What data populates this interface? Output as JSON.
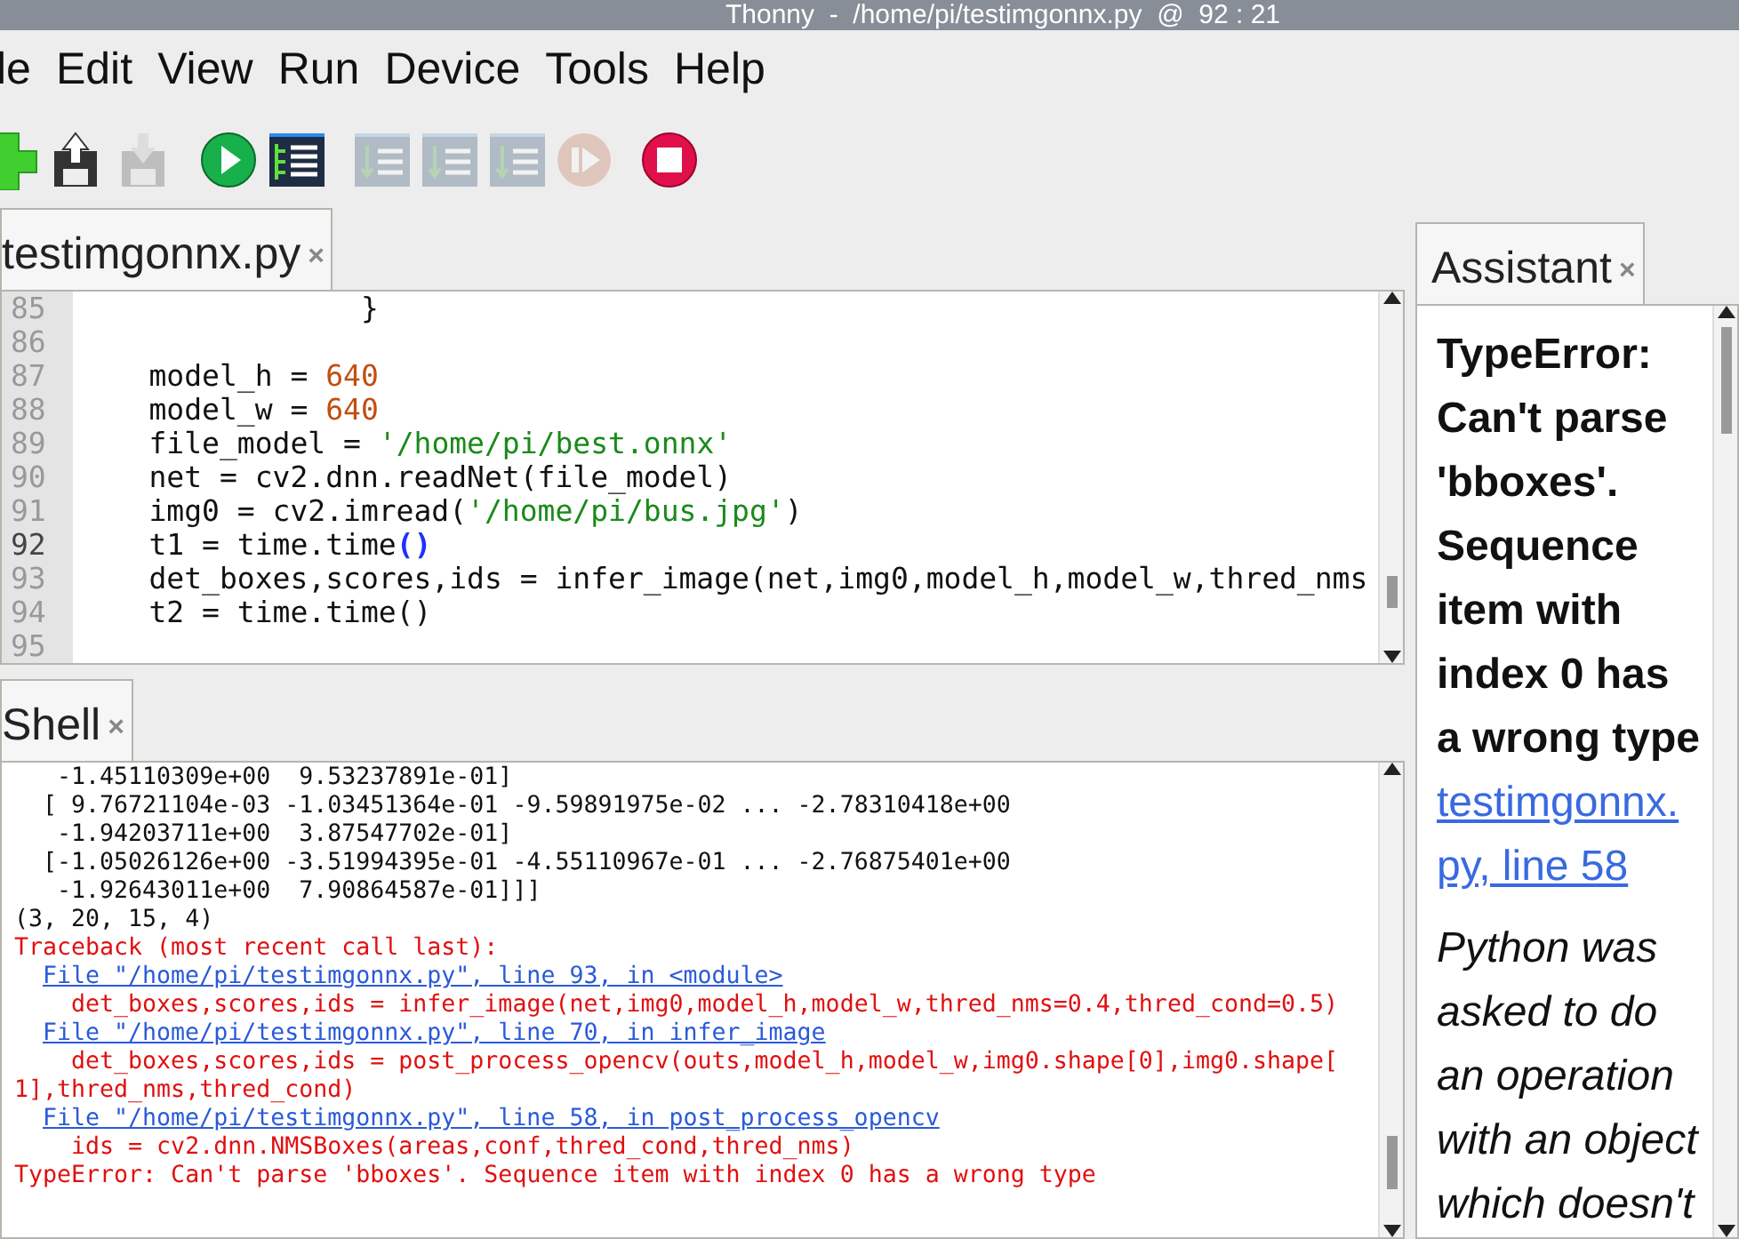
{
  "window": {
    "title": "Thonny  -  /home/pi/testimgonnx.py  @  92 : 21"
  },
  "menu": [
    "le",
    "Edit",
    "View",
    "Run",
    "Device",
    "Tools",
    "Help"
  ],
  "toolbar": [
    {
      "kind": "new",
      "disabled": false
    },
    {
      "kind": "load",
      "disabled": false
    },
    {
      "kind": "save",
      "disabled": true
    },
    {
      "kind": "run",
      "disabled": false
    },
    {
      "kind": "debug",
      "disabled": false
    },
    {
      "kind": "step_over",
      "disabled": true
    },
    {
      "kind": "step_into",
      "disabled": true
    },
    {
      "kind": "step_out",
      "disabled": true
    },
    {
      "kind": "resume",
      "disabled": true
    },
    {
      "kind": "stop",
      "disabled": false
    }
  ],
  "editor_tabs": [
    {
      "label": "testimgonnx.py",
      "close": "×",
      "selected": true
    }
  ],
  "editor": {
    "lines": [
      {
        "number": "85",
        "current": false,
        "segments": [
          {
            "kind": "plain",
            "text": "                }"
          }
        ]
      },
      {
        "number": "86",
        "current": false
      },
      {
        "number": "87",
        "current": false,
        "segments": [
          {
            "kind": "plain",
            "text": "    model_h = "
          },
          {
            "kind": "number",
            "text": "640"
          }
        ]
      },
      {
        "number": "88",
        "current": false,
        "segments": [
          {
            "kind": "plain",
            "text": "    model_w = "
          },
          {
            "kind": "number",
            "text": "640"
          }
        ]
      },
      {
        "number": "89",
        "current": false,
        "segments": [
          {
            "kind": "plain",
            "text": "    file_model = "
          },
          {
            "kind": "string",
            "text": "'/home/pi/best.onnx'"
          }
        ]
      },
      {
        "number": "90",
        "current": false,
        "segments": [
          {
            "kind": "plain",
            "text": "    net = cv2.dnn.readNet(file_model)"
          }
        ]
      },
      {
        "number": "91",
        "current": false,
        "segments": [
          {
            "kind": "plain",
            "text": "    img0 = cv2.imread("
          },
          {
            "kind": "string",
            "text": "'/home/pi/bus.jpg'"
          },
          {
            "kind": "plain",
            "text": ")"
          }
        ]
      },
      {
        "number": "92",
        "current": true,
        "segments": [
          {
            "kind": "plain",
            "text": "    t1 = time.time"
          },
          {
            "kind": "bracket",
            "text": "()"
          }
        ]
      },
      {
        "number": "93",
        "current": false,
        "segments": [
          {
            "kind": "plain",
            "text": "    det_boxes,scores,ids = infer_image(net,img0,model_h,model_w,thred_nms"
          }
        ]
      },
      {
        "number": "94",
        "current": false,
        "segments": [
          {
            "kind": "plain",
            "text": "    t2 = time.time()"
          }
        ]
      },
      {
        "number": "95",
        "current": false
      }
    ]
  },
  "shell_tabs": [
    {
      "label": "Shell",
      "close": "×",
      "selected": true
    }
  ],
  "shell": {
    "lines": [
      {
        "kind": "output",
        "text": "   -1.45110309e+00  9.53237891e-01]"
      },
      {
        "kind": "output",
        "text": "  [ 9.76721104e-03 -1.03451364e-01 -9.59891975e-02 ... -2.78310418e+00"
      },
      {
        "kind": "output",
        "text": "   -1.94203711e+00  3.87547702e-01]"
      },
      {
        "kind": "output",
        "text": "  [-1.05026126e+00 -3.51994395e-01 -4.55110967e-01 ... -2.76875401e+00"
      },
      {
        "kind": "output",
        "text": "   -1.92643011e+00  7.90864587e-01]]]"
      },
      {
        "kind": "output",
        "text": "(3, 20, 15, 4)"
      },
      {
        "kind": "error",
        "text": "Traceback (most recent call last):"
      },
      {
        "kind": "link",
        "text": "File \"/home/pi/testimgonnx.py\", line 93, in <module>"
      },
      {
        "kind": "error",
        "text": "    det_boxes,scores,ids = infer_image(net,img0,model_h,model_w,thred_nms=0.4,thred_cond=0.5)"
      },
      {
        "kind": "link",
        "text": "File \"/home/pi/testimgonnx.py\", line 70, in infer_image"
      },
      {
        "kind": "error",
        "text": "    det_boxes,scores,ids = post_process_opencv(outs,model_h,model_w,img0.shape[0],img0.shape["
      },
      {
        "kind": "error",
        "text": "1],thred_nms,thred_cond)"
      },
      {
        "kind": "link",
        "text": "File \"/home/pi/testimgonnx.py\", line 58, in post_process_opencv"
      },
      {
        "kind": "error",
        "text": "    ids = cv2.dnn.NMSBoxes(areas,conf,thred_cond,thred_nms)"
      },
      {
        "kind": "error",
        "text": "TypeError: Can't parse 'bboxes'. Sequence item with index 0 has a wrong type"
      }
    ]
  },
  "assistant_tabs": [
    {
      "label": "Assistant",
      "close": "×",
      "selected": true
    }
  ],
  "assistant": {
    "heading": "TypeError: Can't parse 'bboxes'. Sequence item with index 0 has a wrong type",
    "link": "testimgonnx.py, line 58",
    "explanation": "Python was asked to do an operation with an object which doesn't"
  }
}
